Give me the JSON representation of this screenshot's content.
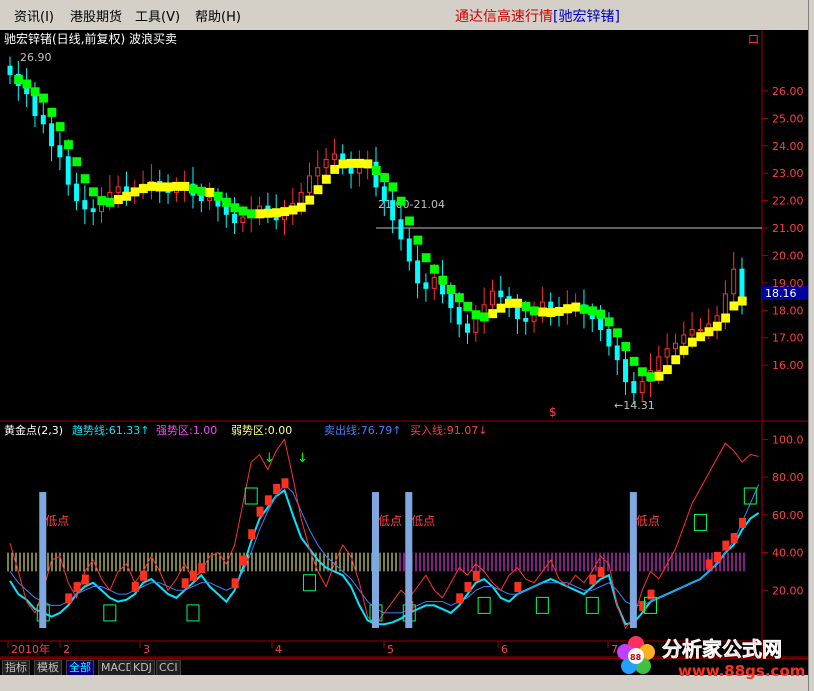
{
  "menu": {
    "items": [
      "资讯(I)",
      "港股期货",
      "工具(V)",
      "帮助(H)"
    ],
    "app_title": "通达信高速行情",
    "stock_tag": "[驰宏锌锗]"
  },
  "main_chart": {
    "header": "驰宏锌锗(日线,前复权) 波浪买卖",
    "high_label": "26.90",
    "low_label": "←14.31",
    "level_line_label": "21.00-21.04",
    "current_price": "18.16",
    "price_marker": "$",
    "corner_mark": "口"
  },
  "indicator": {
    "name": "黄金点(2,3)",
    "params": [
      {
        "label": "趋势线:61.33",
        "arrow": "↑",
        "color": "#00e5ff"
      },
      {
        "label": "强势区:1.00",
        "arrow": "",
        "color": "#ff40ff"
      },
      {
        "label": "弱势区:0.00",
        "arrow": "",
        "color": "#ffff80"
      },
      {
        "label": "卖出线:76.79",
        "arrow": "↑",
        "color": "#4080ff"
      },
      {
        "label": "买入线:91.07",
        "arrow": "↓",
        "color": "#ff4040"
      }
    ],
    "low_point_label": "低点"
  },
  "chart_data": {
    "type": "candlestick",
    "title": "驰宏锌锗(日线,前复权) 波浪买卖",
    "price_axis": {
      "ticks": [
        "26.00",
        "25.00",
        "24.00",
        "23.00",
        "22.00",
        "21.00",
        "20.00",
        "19.00",
        "18.00",
        "17.00",
        "16.00"
      ],
      "range": [
        14.0,
        27.2
      ]
    },
    "indicator_axis": {
      "ticks": [
        "100.0",
        "80.00",
        "60.00",
        "40.00",
        "20.00"
      ],
      "range": [
        0,
        105
      ]
    },
    "time_axis": [
      "2010年",
      "2",
      "3",
      "4",
      "5",
      "6",
      "7"
    ],
    "series": [
      {
        "name": "close",
        "values": [
          26.6,
          26.2,
          25.9,
          25.1,
          24.8,
          24.0,
          23.6,
          22.6,
          22.0,
          21.7,
          21.6,
          22.0,
          22.3,
          22.5,
          22.3,
          22.4,
          22.6,
          22.7,
          22.4,
          22.3,
          22.5,
          22.6,
          22.2,
          22.0,
          22.1,
          21.8,
          21.5,
          21.2,
          21.4,
          21.6,
          21.8,
          21.6,
          21.3,
          21.6,
          21.9,
          22.3,
          22.9,
          23.2,
          23.5,
          23.7,
          23.3,
          23.0,
          23.2,
          23.4,
          22.5,
          22.0,
          21.3,
          20.6,
          19.8,
          19.0,
          18.8,
          19.2,
          18.6,
          18.1,
          17.5,
          17.2,
          17.7,
          18.2,
          18.7,
          18.5,
          18.1,
          17.7,
          17.6,
          17.9,
          18.3,
          18.0,
          17.9,
          18.1,
          18.2,
          17.9,
          17.7,
          17.3,
          16.7,
          16.2,
          15.4,
          15.0,
          15.4,
          15.8,
          16.3,
          16.6,
          16.8,
          17.1,
          17.3,
          17.3,
          17.5,
          17.8,
          18.6,
          19.5,
          18.2
        ]
      },
      {
        "name": "趋势线",
        "values": [
          25,
          18,
          15,
          10,
          8,
          6,
          8,
          12,
          18,
          22,
          24,
          20,
          16,
          14,
          15,
          18,
          24,
          26,
          22,
          18,
          16,
          20,
          24,
          28,
          22,
          18,
          14,
          20,
          32,
          46,
          58,
          64,
          70,
          73,
          60,
          48,
          42,
          36,
          32,
          30,
          28,
          22,
          12,
          4,
          2,
          2,
          3,
          5,
          8,
          10,
          12,
          12,
          10,
          8,
          12,
          18,
          24,
          26,
          22,
          16,
          14,
          18,
          20,
          22,
          24,
          26,
          24,
          22,
          20,
          18,
          22,
          26,
          28,
          12,
          2,
          3,
          8,
          14,
          16,
          18,
          20,
          22,
          24,
          26,
          30,
          34,
          40,
          44,
          52,
          58,
          61
        ]
      },
      {
        "name": "卖出线",
        "values": [
          30,
          24,
          20,
          16,
          14,
          12,
          12,
          14,
          18,
          20,
          22,
          22,
          20,
          18,
          18,
          20,
          22,
          24,
          24,
          22,
          20,
          20,
          22,
          24,
          24,
          22,
          20,
          22,
          30,
          40,
          52,
          62,
          70,
          76,
          72,
          62,
          52,
          44,
          38,
          34,
          30,
          26,
          20,
          14,
          10,
          8,
          8,
          8,
          10,
          12,
          14,
          14,
          14,
          12,
          14,
          16,
          20,
          22,
          22,
          20,
          18,
          18,
          20,
          22,
          24,
          24,
          24,
          24,
          22,
          20,
          20,
          22,
          24,
          20,
          14,
          12,
          12,
          14,
          16,
          18,
          20,
          22,
          24,
          26,
          30,
          34,
          40,
          46,
          56,
          66,
          76
        ]
      },
      {
        "name": "买入线",
        "values": [
          45,
          30,
          14,
          8,
          20,
          36,
          38,
          24,
          16,
          30,
          36,
          26,
          20,
          30,
          34,
          24,
          30,
          38,
          30,
          20,
          26,
          34,
          26,
          30,
          38,
          40,
          34,
          44,
          66,
          88,
          92,
          84,
          94,
          100,
          80,
          58,
          42,
          30,
          22,
          34,
          44,
          38,
          24,
          6,
          2,
          8,
          14,
          20,
          16,
          22,
          28,
          20,
          16,
          24,
          32,
          28,
          34,
          30,
          24,
          20,
          28,
          32,
          26,
          24,
          30,
          36,
          26,
          22,
          28,
          24,
          30,
          38,
          34,
          12,
          0,
          6,
          20,
          30,
          26,
          34,
          42,
          54,
          66,
          74,
          82,
          90,
          98,
          94,
          88,
          92,
          91
        ]
      }
    ]
  }
}
